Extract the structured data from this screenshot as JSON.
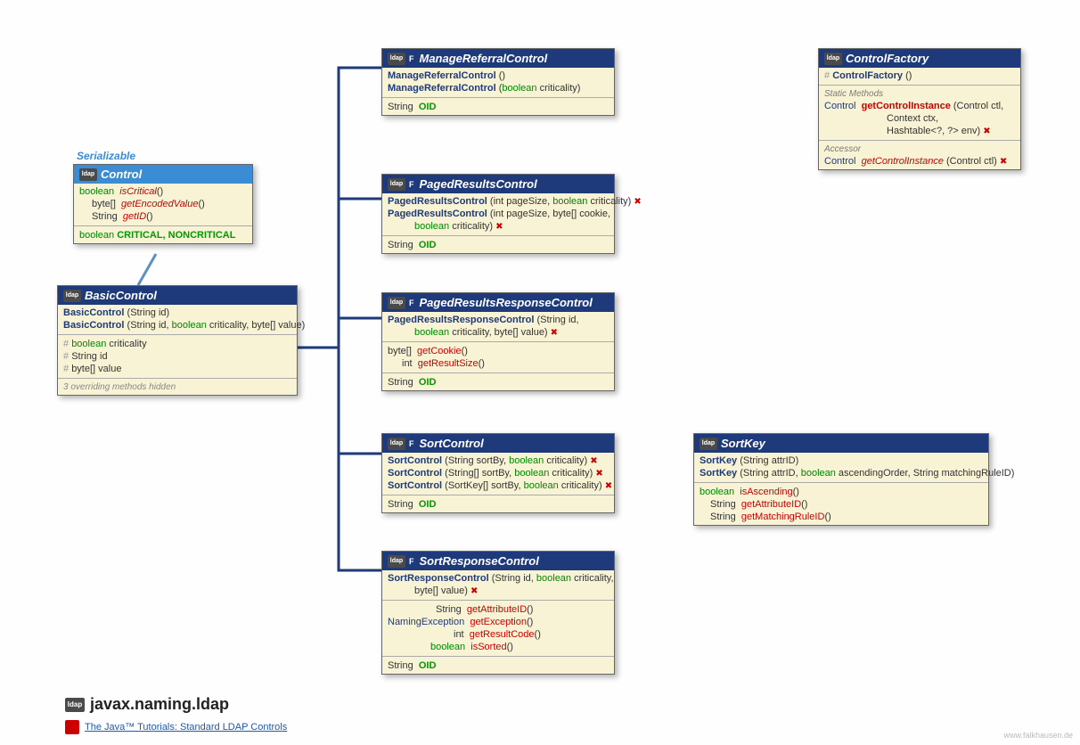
{
  "colors": {
    "header_dark": "#1e3a7b",
    "header_light": "#3a8cd4",
    "body": "#f8f3d5",
    "bool": "#008800",
    "name": "#cc0000"
  },
  "serializable_label": "Serializable",
  "control": {
    "title": "Control",
    "m1_ret": "boolean",
    "m1_name": "isCritical",
    "m1_post": "()",
    "m2_ret": "byte[]",
    "m2_name": "getEncodedValue",
    "m2_post": "()",
    "m3_ret": "String",
    "m3_name": "getID",
    "m3_post": "()",
    "const_ret": "boolean",
    "const_names": "CRITICAL, NONCRITICAL"
  },
  "basic": {
    "title": "BasicControl",
    "c1": "BasicControl",
    "c1_params": "(String id)",
    "c2": "BasicControl",
    "c2_params_pre": "(String id, ",
    "c2_params_bool": "boolean",
    "c2_params_mid": " criticality, byte[] value)",
    "f1_ret": "boolean",
    "f1_name": "criticality",
    "f2_ret": "String",
    "f2_name": "id",
    "f3_ret": "byte[]",
    "f3_name": "value",
    "hidden": "3 overriding methods hidden"
  },
  "manage": {
    "title": "ManageReferralControl",
    "c1": "ManageReferralControl",
    "c1_params": "()",
    "c2": "ManageReferralControl",
    "c2_pre": "(",
    "c2_bool": "boolean",
    "c2_post": " criticality)",
    "oid_ret": "String",
    "oid": "OID"
  },
  "paged": {
    "title": "PagedResultsControl",
    "c1": "PagedResultsControl",
    "c1_pre": "(int pageSize, ",
    "c1_bool": "boolean",
    "c1_post": " criticality)",
    "c1_exc": "✖",
    "c2": "PagedResultsControl",
    "c2_pre": "(int pageSize, byte[] cookie,",
    "c2_line2_bool": "boolean",
    "c2_line2_post": " criticality)",
    "c2_exc": "✖",
    "oid_ret": "String",
    "oid": "OID"
  },
  "pagedresp": {
    "title": "PagedResultsResponseControl",
    "c1": "PagedResultsResponseControl",
    "c1_pre": "(String id,",
    "c1_line2_bool": "boolean",
    "c1_line2_post": " criticality, byte[] value)",
    "c1_exc": "✖",
    "m1_ret": "byte[]",
    "m1_name": "getCookie",
    "m1_post": "()",
    "m2_ret": "int",
    "m2_name": "getResultSize",
    "m2_post": "()",
    "oid_ret": "String",
    "oid": "OID"
  },
  "sortctrl": {
    "title": "SortControl",
    "c1": "SortControl",
    "c1_pre": "(String sortBy, ",
    "c1_bool": "boolean",
    "c1_post": " criticality)",
    "c1_exc": "✖",
    "c2": "SortControl",
    "c2_pre": "(String[] sortBy, ",
    "c2_bool": "boolean",
    "c2_post": " criticality)",
    "c2_exc": "✖",
    "c3": "SortControl",
    "c3_pre": "(SortKey[] sortBy, ",
    "c3_bool": "boolean",
    "c3_post": " criticality)",
    "c3_exc": "✖",
    "oid_ret": "String",
    "oid": "OID"
  },
  "sortresp": {
    "title": "SortResponseControl",
    "c1": "SortResponseControl",
    "c1_pre": "(String id, ",
    "c1_bool": "boolean",
    "c1_post": " criticality,",
    "c1_line2": "byte[] value)",
    "c1_exc": "✖",
    "m1_ret": "String",
    "m1_name": "getAttributeID",
    "m1_post": "()",
    "m2_ret": "NamingException",
    "m2_name": "getException",
    "m2_post": "()",
    "m3_ret": "int",
    "m3_name": "getResultCode",
    "m3_post": "()",
    "m4_ret": "boolean",
    "m4_name": "isSorted",
    "m4_post": "()",
    "oid_ret": "String",
    "oid": "OID"
  },
  "sortkey": {
    "title": "SortKey",
    "c1": "SortKey",
    "c1_params": "(String attrID)",
    "c2": "SortKey",
    "c2_pre": "(String attrID, ",
    "c2_bool": "boolean",
    "c2_mid": " ascendingOrder, String matchingRuleID)",
    "m1_ret": "boolean",
    "m1_name": "isAscending",
    "m1_post": "()",
    "m2_ret": "String",
    "m2_name": "getAttributeID",
    "m2_post": "()",
    "m3_ret": "String",
    "m3_name": "getMatchingRuleID",
    "m3_post": "()"
  },
  "factory": {
    "title": "ControlFactory",
    "c1": "ControlFactory",
    "c1_params": "()",
    "static_label": "Static Methods",
    "s1_ret": "Control",
    "s1_name": "getControlInstance",
    "s1_pre": "(Control ctl,",
    "s1_l2": "Context ctx,",
    "s1_l3": "Hashtable<?, ?> env)",
    "s1_exc": "✖",
    "acc_label": "Accessor",
    "a1_ret": "Control",
    "a1_name": "getControlInstance",
    "a1_params": "(Control ctl)",
    "a1_exc": "✖"
  },
  "footer": {
    "package": "javax.naming.ldap",
    "link": "The Java™ Tutorials: Standard LDAP Controls",
    "watermark": "www.falkhausen.de"
  },
  "icon_text": "ldap",
  "final_marker": "F",
  "hash": "#"
}
